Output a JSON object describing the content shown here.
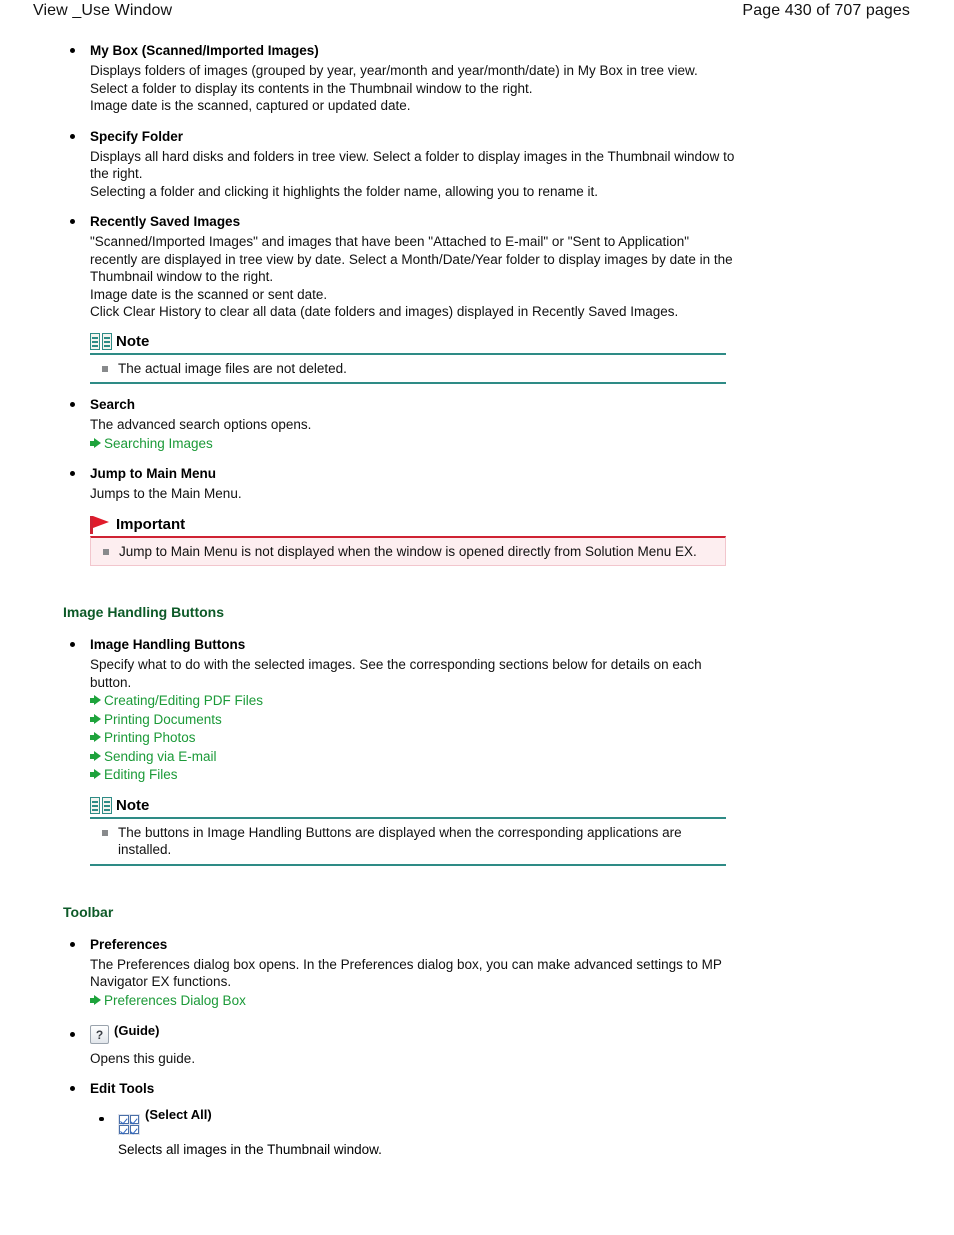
{
  "header": {
    "title": "View _Use Window",
    "page_label": "Page 430 of 707 pages"
  },
  "sections": {
    "intro_items": [
      {
        "title": "My Box (Scanned/Imported Images)",
        "lines": [
          "Displays folders of images (grouped by year, year/month and year/month/date) in My Box in tree view. Select a folder to display its contents in the Thumbnail window to the right.",
          "Image date is the scanned, captured or updated date."
        ]
      },
      {
        "title": "Specify Folder",
        "lines": [
          "Displays all hard disks and folders in tree view. Select a folder to display images in the Thumbnail window to the right.",
          "Selecting a folder and clicking it highlights the folder name, allowing you to rename it."
        ]
      },
      {
        "title": "Recently Saved Images",
        "lines": [
          "\"Scanned/Imported Images\" and images that have been \"Attached to E-mail\" or \"Sent to Application\" recently are displayed in tree view by date. Select a Month/Date/Year folder to display images by date in the Thumbnail window to the right.",
          "Image date is the scanned or sent date.",
          "Click Clear History to clear all data (date folders and images) displayed in Recently Saved Images."
        ]
      }
    ],
    "note_1": {
      "icon": "book-icon",
      "title": "Note",
      "items": [
        "The actual image files are not deleted."
      ]
    },
    "search_item": {
      "title": "Search",
      "lines": [
        "The advanced search options opens."
      ],
      "links": [
        "Searching Images"
      ]
    },
    "jump_item": {
      "title": "Jump to Main Menu",
      "lines": [
        "Jumps to the Main Menu."
      ]
    },
    "important_1": {
      "icon": "flag-icon",
      "title": "Important",
      "items": [
        "Jump to Main Menu is not displayed when the window is opened directly from Solution Menu EX."
      ]
    },
    "image_handling": {
      "heading": "Image Handling Buttons",
      "item": {
        "title": "Image Handling Buttons",
        "lines": [
          "Specify what to do with the selected images. See the corresponding sections below for details on each button."
        ],
        "links": [
          "Creating/Editing PDF Files",
          "Printing Documents",
          "Printing Photos",
          "Sending via E-mail",
          "Editing Files"
        ]
      },
      "note": {
        "icon": "book-icon",
        "title": "Note",
        "items": [
          "The buttons in Image Handling Buttons are displayed when the corresponding applications are installed."
        ]
      }
    },
    "toolbar": {
      "heading": "Toolbar",
      "preferences": {
        "title": "Preferences",
        "lines": [
          "The Preferences dialog box opens. In the Preferences dialog box, you can make advanced settings to MP Navigator EX functions."
        ],
        "links": [
          "Preferences Dialog Box"
        ]
      },
      "guide": {
        "icon": "question-mark-button-icon",
        "icon_glyph": "?",
        "label": "(Guide)",
        "lines": [
          "Opens this guide."
        ]
      },
      "edit_tools": {
        "title": "Edit Tools",
        "select_all": {
          "icon": "select-all-icon",
          "label": "(Select All)",
          "lines": [
            "Selects all images in the Thumbnail window."
          ]
        }
      }
    }
  },
  "colors": {
    "link_green": "#1b9a38",
    "heading_green": "#0d5a28",
    "note_teal": "#2e8b86",
    "important_red": "#cf2233",
    "important_bg": "#fdeef0"
  }
}
